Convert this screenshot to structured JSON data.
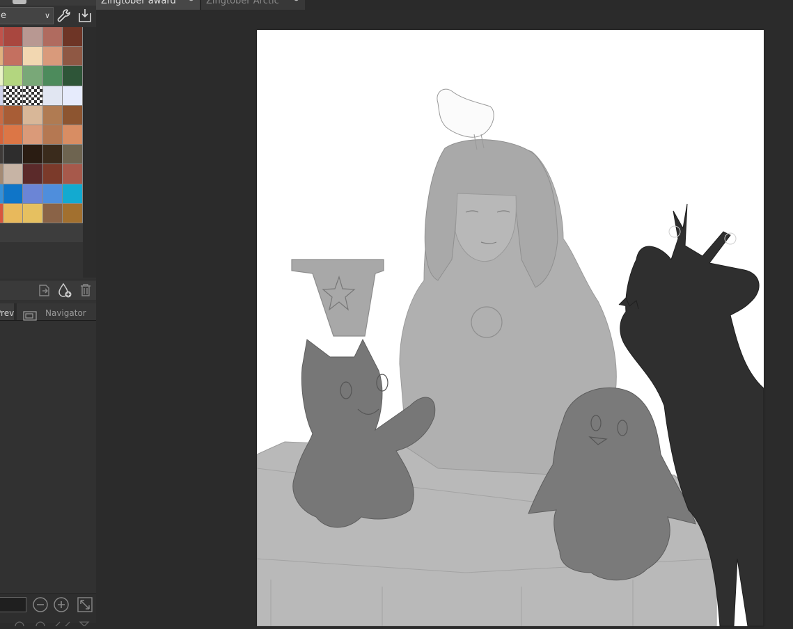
{
  "app": {
    "document_tabs": [
      {
        "label": "Zingtober award",
        "active": true
      },
      {
        "label": "Zingtober Arctic",
        "active": false
      }
    ]
  },
  "left_panel": {
    "color_set_select": {
      "value": "e"
    },
    "palette": {
      "rows": [
        [
          "#c0534b",
          "#a9473f",
          "#b89892",
          "#b06b5f",
          "#6e3526"
        ],
        [
          "#e0b07e",
          "#c47060",
          "#f2d7b1",
          "#d99a7b",
          "#8f5844"
        ],
        [
          "#e9f3c6",
          "#b3d67f",
          "#79a878",
          "#4d8b5c",
          "#2e5538"
        ],
        [
          "#cfd3ea",
          "transparent",
          "transparent",
          "#e1e6f2",
          "#e6ebfc"
        ],
        [
          "#c96b44",
          "#a85d36",
          "#d8b798",
          "#b07b52",
          "#8d5530"
        ],
        [
          "#d6643c",
          "#dc7646",
          "#da9a79",
          "#b57852",
          "#d88d63"
        ],
        [
          "#3e3a38",
          "#2e2d2d",
          "#2a1c12",
          "#3a2b1c",
          "#6e6450"
        ],
        [
          "#a48a74",
          "#c7b4a5",
          "#5b2a2a",
          "#7b3a2a",
          "#a7594b"
        ],
        [
          "#3690d8",
          "#0f75c8",
          "#6b85d6",
          "#4f8edc",
          "#13aad0"
        ],
        [
          "#d8563e",
          "#e8b95c",
          "#e6c060",
          "#8a6347",
          "#a2702f"
        ]
      ]
    },
    "panel_tabs": [
      {
        "label": "Preview"
      },
      {
        "label": "Navigator"
      }
    ],
    "icons": [
      "wrench-icon",
      "import-icon",
      "page-copy-icon",
      "add-color-icon",
      "trash-icon",
      "navigator-icon",
      "zoom-out-icon",
      "zoom-in-icon",
      "fit-icon"
    ]
  },
  "colors": {
    "workspace_bg": "#2b2b2b",
    "panel_bg": "#323232",
    "active_tab_bg": "#474747",
    "canvas_bg": "#ffffff"
  }
}
